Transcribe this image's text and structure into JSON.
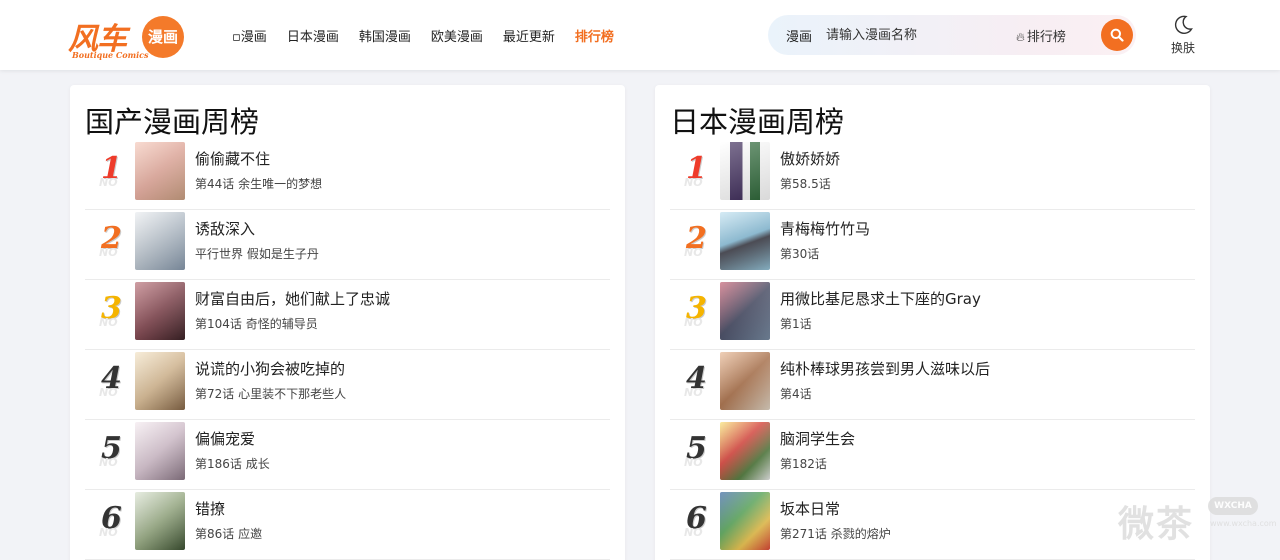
{
  "header": {
    "logo": {
      "main": "风车",
      "circle": "漫画",
      "sub": "Boutique Comics"
    },
    "nav": [
      {
        "label": "▫漫画",
        "active": false
      },
      {
        "label": "日本漫画",
        "active": false
      },
      {
        "label": "韩国漫画",
        "active": false
      },
      {
        "label": "欧美漫画",
        "active": false
      },
      {
        "label": "最近更新",
        "active": false
      },
      {
        "label": "排行榜",
        "active": true
      }
    ],
    "search": {
      "category": "漫画",
      "placeholder": "请输入漫画名称",
      "rank_link": "排行榜",
      "button_icon": "search-icon"
    },
    "theme": {
      "label": "换肤",
      "icon": "moon-icon"
    }
  },
  "colors": {
    "accent": "#f26f21",
    "rank1": "#ee3b2a",
    "rank2": "#f26f21",
    "rank3": "#f5b400",
    "rank_other": "#333333"
  },
  "panels": [
    {
      "title": "国产漫画周榜",
      "items": [
        {
          "rank": "1",
          "title": "偷偷藏不住",
          "sub": "第44话 余生唯一的梦想"
        },
        {
          "rank": "2",
          "title": "诱敌深入",
          "sub": "平行世界 假如是生子丹"
        },
        {
          "rank": "3",
          "title": "财富自由后，她们献上了忠诚",
          "sub": "第104话 奇怪的辅导员"
        },
        {
          "rank": "4",
          "title": "说谎的小狗会被吃掉的",
          "sub": "第72话 心里装不下那老些人"
        },
        {
          "rank": "5",
          "title": "偏偏宠爱",
          "sub": "第186话 成长"
        },
        {
          "rank": "6",
          "title": "错撩",
          "sub": "第86话 应邀"
        }
      ]
    },
    {
      "title": "日本漫画周榜",
      "items": [
        {
          "rank": "1",
          "title": "傲娇娇娇",
          "sub": "第58.5话"
        },
        {
          "rank": "2",
          "title": "青梅梅竹竹马",
          "sub": "第30话"
        },
        {
          "rank": "3",
          "title": "用微比基尼恳求土下座的Gray",
          "sub": "第1话"
        },
        {
          "rank": "4",
          "title": "纯朴棒球男孩尝到男人滋味以后",
          "sub": "第4话"
        },
        {
          "rank": "5",
          "title": "脑洞学生会",
          "sub": "第182话"
        },
        {
          "rank": "6",
          "title": "坂本日常",
          "sub": "第271话 杀戮的熔炉"
        }
      ]
    }
  ],
  "watermark": {
    "text": "微茶",
    "badge": "WXCHA",
    "url": "www.wxcha.com"
  }
}
